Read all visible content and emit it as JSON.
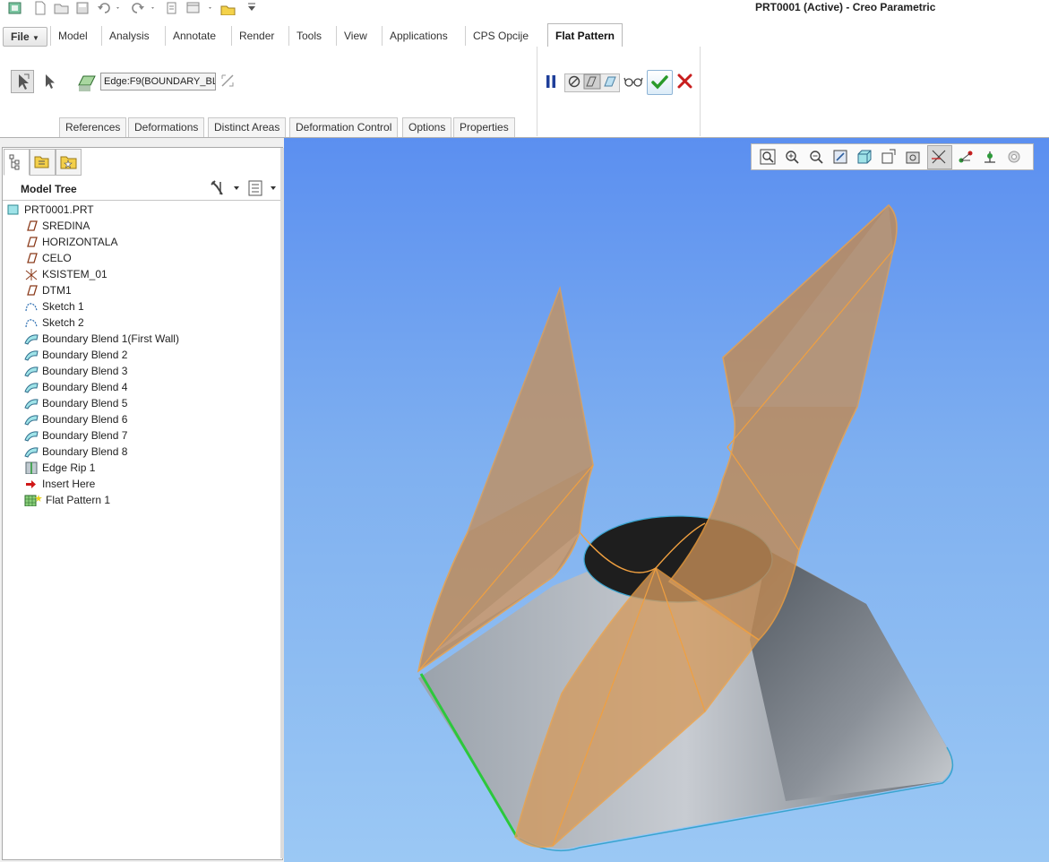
{
  "app": {
    "window_title": "PRT0001 (Active) - Creo Parametric"
  },
  "ribbon": {
    "tabs": [
      "File",
      "Model",
      "Analysis",
      "Annotate",
      "Render",
      "Tools",
      "View",
      "Applications",
      "CPS Opcije",
      "Flat Pattern"
    ],
    "active_tab": "Flat Pattern",
    "file_label": "File",
    "edge_reference_value": "Edge:F9(BOUNDARY_BL",
    "sub_tabs": [
      "References",
      "Deformations",
      "Distinct Areas",
      "Deformation Control",
      "Options",
      "Properties"
    ]
  },
  "model_tree": {
    "title": "Model Tree",
    "items": [
      {
        "label": "PRT0001.PRT",
        "icon": "part-icon"
      },
      {
        "label": "SREDINA",
        "icon": "datum-plane-icon"
      },
      {
        "label": "HORIZONTALA",
        "icon": "datum-plane-icon"
      },
      {
        "label": "CELO",
        "icon": "datum-plane-icon"
      },
      {
        "label": "KSISTEM_01",
        "icon": "coordinate-system-icon"
      },
      {
        "label": "DTM1",
        "icon": "datum-plane-icon"
      },
      {
        "label": "Sketch 1",
        "icon": "sketch-icon"
      },
      {
        "label": "Sketch 2",
        "icon": "sketch-icon"
      },
      {
        "label": "Boundary Blend 1(First Wall)",
        "icon": "boundary-blend-icon"
      },
      {
        "label": "Boundary Blend 2",
        "icon": "boundary-blend-icon"
      },
      {
        "label": "Boundary Blend 3",
        "icon": "boundary-blend-icon"
      },
      {
        "label": "Boundary Blend 4",
        "icon": "boundary-blend-icon"
      },
      {
        "label": "Boundary Blend 5",
        "icon": "boundary-blend-icon"
      },
      {
        "label": "Boundary Blend 6",
        "icon": "boundary-blend-icon"
      },
      {
        "label": "Boundary Blend 7",
        "icon": "boundary-blend-icon"
      },
      {
        "label": "Boundary Blend 8",
        "icon": "boundary-blend-icon"
      },
      {
        "label": "Edge Rip 1",
        "icon": "edge-rip-icon"
      },
      {
        "label": "Insert Here",
        "icon": "insert-here-arrow-icon"
      },
      {
        "label": "Flat Pattern 1",
        "icon": "flat-pattern-icon"
      }
    ]
  },
  "colors": {
    "viewport_top": "#5b8ff0",
    "viewport_bottom": "#9bc8f4",
    "highlight_orange": "#f0a040",
    "confirm_green": "#2a9a2a",
    "cancel_red": "#c81e1e"
  }
}
